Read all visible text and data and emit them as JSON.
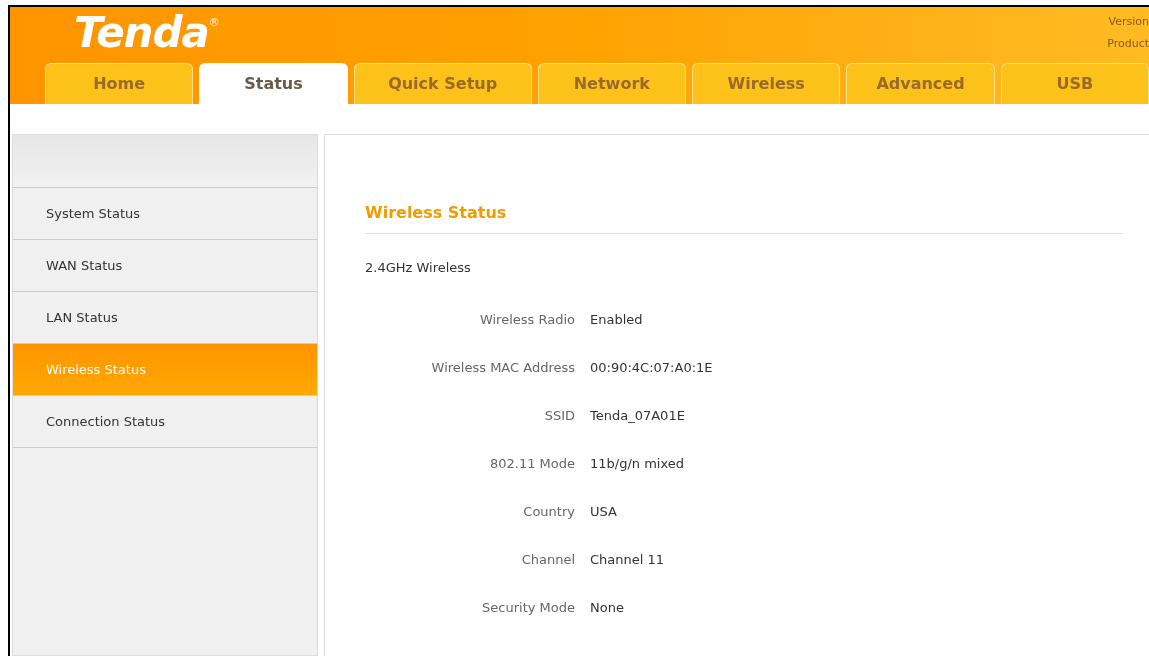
{
  "header": {
    "logo": "Tenda",
    "logo_mark": "®",
    "info": [
      "Version",
      "Product"
    ]
  },
  "tabs": [
    {
      "label": "Home",
      "selected": false
    },
    {
      "label": "Status",
      "selected": true
    },
    {
      "label": "Quick Setup",
      "selected": false
    },
    {
      "label": "Network",
      "selected": false
    },
    {
      "label": "Wireless",
      "selected": false
    },
    {
      "label": "Advanced",
      "selected": false
    },
    {
      "label": "USB",
      "selected": false
    }
  ],
  "sidebar": {
    "items": [
      {
        "label": "System Status",
        "selected": false
      },
      {
        "label": "WAN Status",
        "selected": false
      },
      {
        "label": "LAN Status",
        "selected": false
      },
      {
        "label": "Wireless Status",
        "selected": true
      },
      {
        "label": "Connection Status",
        "selected": false
      }
    ]
  },
  "content": {
    "title": "Wireless Status",
    "section": "2.4GHz Wireless",
    "rows": [
      {
        "label": "Wireless Radio",
        "value": "Enabled"
      },
      {
        "label": "Wireless MAC Address",
        "value": "00:90:4C:07:A0:1E"
      },
      {
        "label": "SSID",
        "value": "Tenda_07A01E"
      },
      {
        "label": "802.11 Mode",
        "value": "11b/g/n mixed"
      },
      {
        "label": "Country",
        "value": "USA"
      },
      {
        "label": "Channel",
        "value": "Channel 11"
      },
      {
        "label": "Security Mode",
        "value": "None"
      }
    ]
  }
}
